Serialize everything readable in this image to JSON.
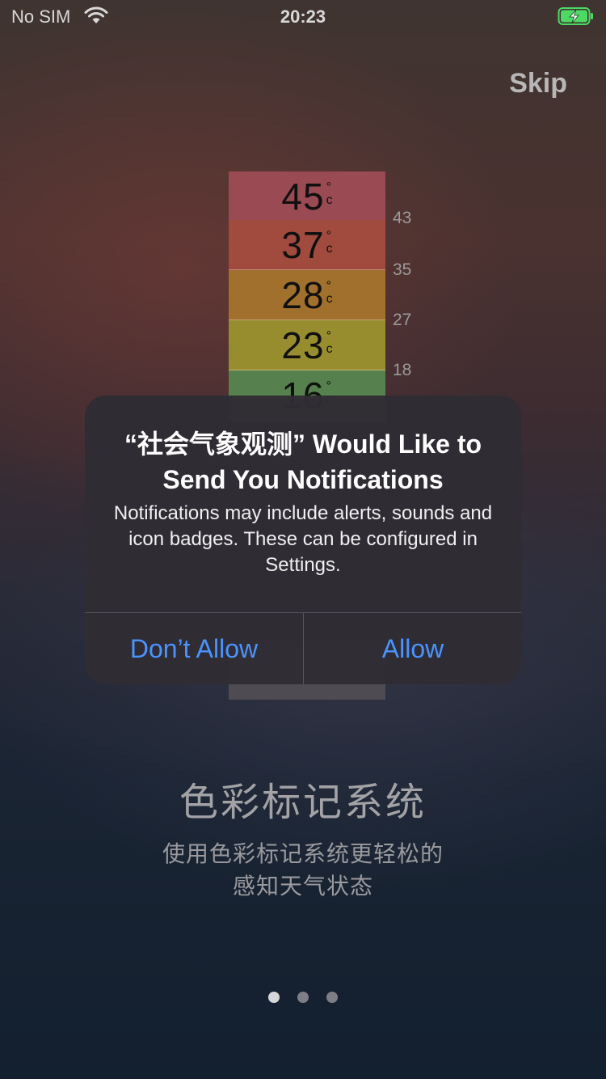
{
  "status_bar": {
    "carrier": "No SIM",
    "wifi_icon": "wifi-icon",
    "time": "20:23",
    "battery_icon": "battery-charging-icon",
    "battery_color": "#4cd964"
  },
  "skip_label": "Skip",
  "scale": {
    "bands": [
      {
        "value": "45",
        "color": "#9a4a52"
      },
      {
        "value": "37",
        "color": "#a14a3e"
      },
      {
        "value": "28",
        "color": "#a0702c"
      },
      {
        "value": "23",
        "color": "#988d2e"
      },
      {
        "value": "16",
        "color": "#56804d"
      }
    ],
    "degree": "°",
    "unit": "c",
    "ticks": [
      "43",
      "35",
      "27",
      "18"
    ]
  },
  "alert": {
    "title": "“社会气象观测” Would Like to Send You Notifications",
    "message": "Notifications may include alerts, sounds and icon badges. These can be configured in Settings.",
    "dont_allow_label": "Don’t Allow",
    "allow_label": "Allow",
    "button_color": "#4a94ff"
  },
  "onboarding": {
    "heading": "色彩标记系统",
    "subtext_line1": "使用色彩标记系统更轻松的",
    "subtext_line2": "感知天气状态"
  },
  "pager": {
    "page_count": 3,
    "active_index": 0
  }
}
